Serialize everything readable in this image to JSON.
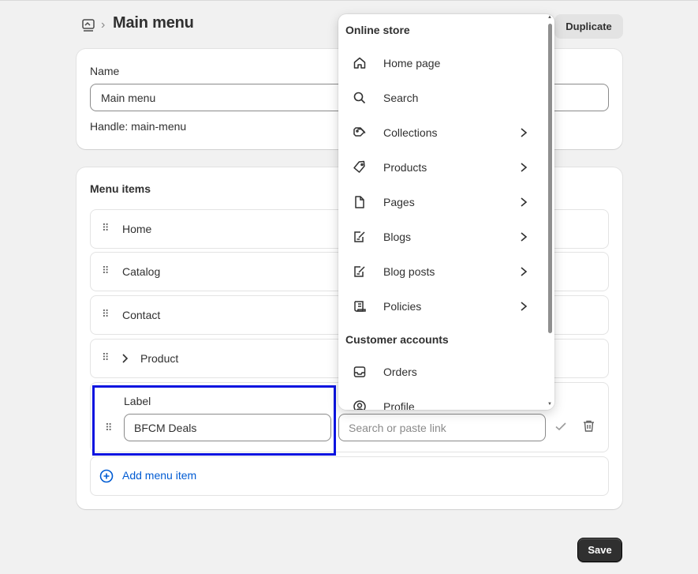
{
  "header": {
    "breadcrumb_icon": "menu-icon",
    "separator": "›",
    "title": "Main menu",
    "duplicate_label": "Duplicate"
  },
  "details": {
    "name_label": "Name",
    "name_value": "Main menu",
    "handle_text": "Handle: main-menu"
  },
  "menu_items": {
    "title": "Menu items",
    "rows": [
      {
        "label": "Home"
      },
      {
        "label": "Catalog"
      },
      {
        "label": "Contact"
      },
      {
        "label": "Product",
        "has_children": true
      }
    ],
    "edit_row": {
      "label_caption": "Label",
      "label_value": "BFCM Deals",
      "link_placeholder": "Search or paste link"
    },
    "add_label": "Add menu item"
  },
  "save_label": "Save",
  "dropdown": {
    "section1": "Online store",
    "items1": [
      {
        "label": "Home page",
        "icon": "home-icon",
        "chevron": false
      },
      {
        "label": "Search",
        "icon": "search-icon",
        "chevron": false
      },
      {
        "label": "Collections",
        "icon": "collections-icon",
        "chevron": true
      },
      {
        "label": "Products",
        "icon": "tag-icon",
        "chevron": true
      },
      {
        "label": "Pages",
        "icon": "page-icon",
        "chevron": true
      },
      {
        "label": "Blogs",
        "icon": "blog-icon",
        "chevron": true
      },
      {
        "label": "Blog posts",
        "icon": "blog-post-icon",
        "chevron": true
      },
      {
        "label": "Policies",
        "icon": "policy-icon",
        "chevron": true
      }
    ],
    "section2": "Customer accounts",
    "items2": [
      {
        "label": "Orders",
        "icon": "orders-icon",
        "chevron": false
      },
      {
        "label": "Profile",
        "icon": "profile-icon",
        "chevron": false
      }
    ]
  },
  "colors": {
    "accent": "#005bd3",
    "focus_outline": "#0a14e0",
    "primary_button": "#303030"
  }
}
